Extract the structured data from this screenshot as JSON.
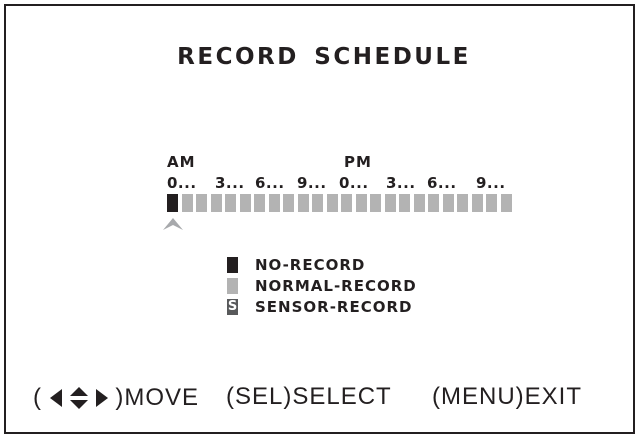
{
  "screen": {
    "title": "RECORD SCHEDULE"
  },
  "timeline": {
    "am_label": "AM",
    "pm_label": "PM",
    "ticks": [
      "0...",
      "3...",
      "6...",
      "9...",
      "0...",
      "3...",
      "6...",
      "9..."
    ],
    "slot_count": 24,
    "slots": [
      "no-record",
      "normal-record",
      "normal-record",
      "normal-record",
      "normal-record",
      "normal-record",
      "normal-record",
      "normal-record",
      "normal-record",
      "normal-record",
      "normal-record",
      "normal-record",
      "normal-record",
      "normal-record",
      "normal-record",
      "normal-record",
      "normal-record",
      "normal-record",
      "normal-record",
      "normal-record",
      "normal-record",
      "normal-record",
      "normal-record",
      "normal-record"
    ],
    "selected_slot": 0
  },
  "legend": {
    "items": [
      {
        "label": "NO-RECORD",
        "mode": "no-record"
      },
      {
        "label": "NORMAL-RECORD",
        "mode": "normal-record"
      },
      {
        "label": "SENSOR-RECORD",
        "mode": "sensor-record",
        "mark": "S"
      }
    ]
  },
  "colors": {
    "no_record": "#231f20",
    "normal_record": "#b3b3b3",
    "sensor_record": "#58595b",
    "cursor": "#a7a9ac"
  },
  "footer": {
    "move_open": "(",
    "move_close": ")MOVE",
    "move_icon": "four-way-arrow-icon",
    "select_label": "(SEL)SELECT",
    "exit_label": "(MENU)EXIT"
  }
}
